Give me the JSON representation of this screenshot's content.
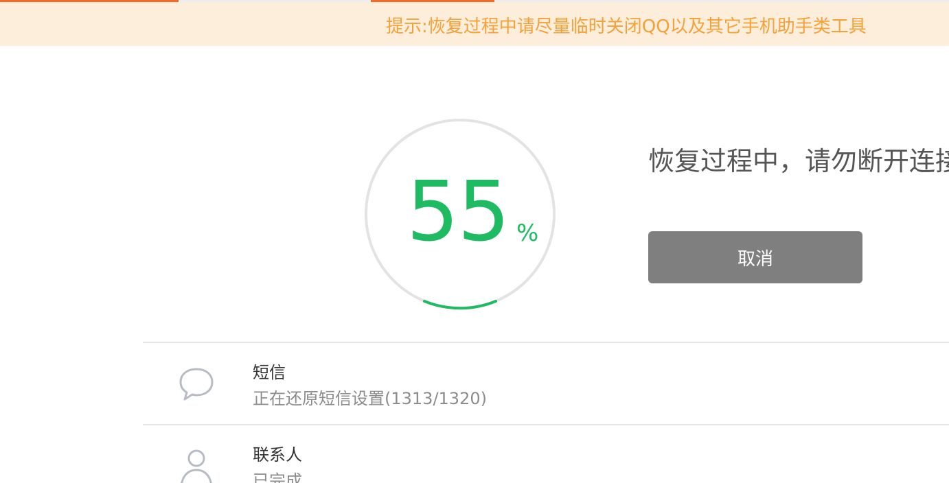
{
  "tip": {
    "text": "提示:恢复过程中请尽量临时关闭QQ以及其它手机助手类工具"
  },
  "progress": {
    "value": "55",
    "unit": "%",
    "fraction": 0.55,
    "color": "#1fbb63"
  },
  "status": {
    "text": "恢复过程中，请勿断开连接"
  },
  "actions": {
    "cancel_label": "取消"
  },
  "items": [
    {
      "icon": "message-bubble-icon",
      "title": "短信",
      "subtitle": "正在还原短信设置(1313/1320)"
    },
    {
      "icon": "person-icon",
      "title": "联系人",
      "subtitle": "已完成"
    }
  ],
  "colors": {
    "accent": "#f26a2b",
    "tip_background": "#fdeedb",
    "tip_text": "#f5a13a",
    "button": "#7f7f7f"
  }
}
